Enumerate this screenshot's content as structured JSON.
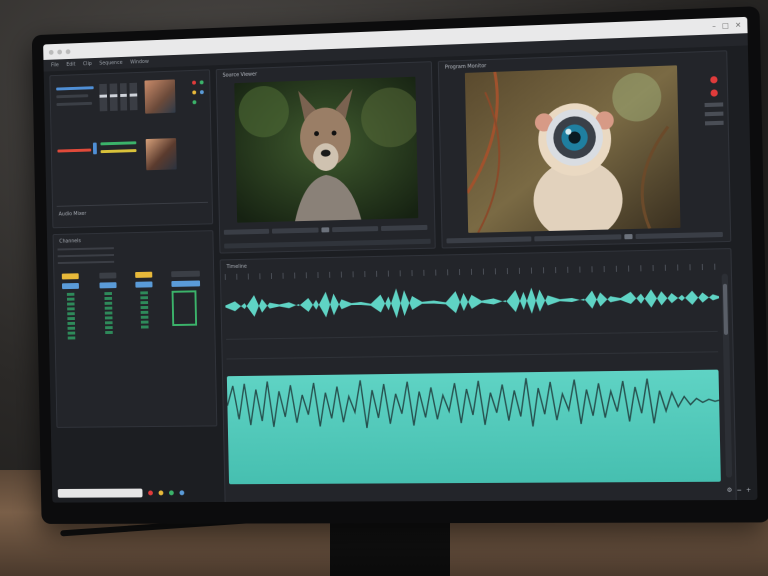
{
  "app": {
    "title": "",
    "menu": [
      "File",
      "Edit",
      "Clip",
      "Sequence",
      "Window"
    ]
  },
  "viewer1": {
    "label": "Source Viewer",
    "timecode": ""
  },
  "viewer2": {
    "label": "Program Monitor",
    "timecode": ""
  },
  "timeline": {
    "label": "Timeline",
    "tabs": [
      "",
      ""
    ]
  },
  "mixer": {
    "label": "Audio Mixer"
  },
  "strips": {
    "label": "Channels"
  },
  "status": {
    "search_placeholder": ""
  },
  "icons": {
    "record": "record-icon",
    "play": "play-icon",
    "settings": "gear-icon"
  },
  "colors": {
    "accent_teal": "#5fd3c4",
    "record_red": "#e03b3b",
    "meter_green": "#2e8a5a",
    "strip_yellow": "#e8b93a",
    "strip_blue": "#5a9bd8"
  }
}
